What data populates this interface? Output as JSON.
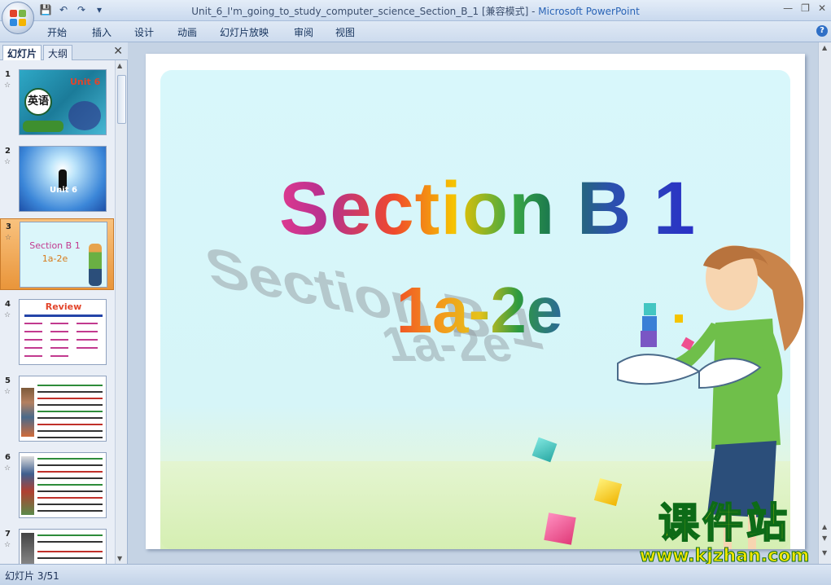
{
  "window": {
    "title": "Unit_6_I'm_going_to_study_computer_science_Section_B_1 [兼容模式] - ",
    "app_name": "Microsoft PowerPoint"
  },
  "ribbon": {
    "tabs": [
      "开始",
      "插入",
      "设计",
      "动画",
      "幻灯片放映",
      "审阅",
      "视图"
    ]
  },
  "left_panel": {
    "tab_slides": "幻灯片",
    "tab_outline": "大纲",
    "thumbnails": [
      {
        "num": "1",
        "text": "Unit 6"
      },
      {
        "num": "2",
        "text": "Unit 6"
      },
      {
        "num": "3",
        "text": "Section B 1",
        "text2": "1a-2e"
      },
      {
        "num": "4",
        "text": "Review"
      },
      {
        "num": "5",
        "text": ""
      },
      {
        "num": "6",
        "text": ""
      },
      {
        "num": "7",
        "text": ""
      }
    ]
  },
  "slide": {
    "heading": "Section B 1",
    "subheading": "1a-2e",
    "watermark_cn": "课件站",
    "watermark_url": "www.kjzhan.com"
  },
  "status": {
    "slide_indicator": "幻灯片 3/51"
  },
  "colors": {
    "selected_thumb": "#e9953a",
    "ribbon_bg": "#cddbee",
    "slide_bg": "#d8f7fb"
  }
}
